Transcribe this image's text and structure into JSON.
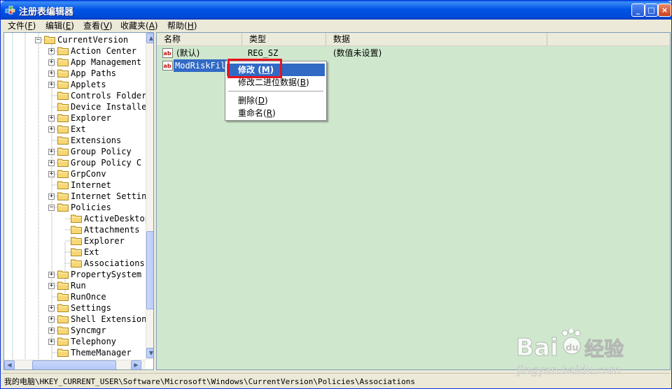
{
  "window": {
    "title": "注册表编辑器",
    "min": "_",
    "max": "□",
    "close": "×"
  },
  "menu": [
    {
      "label": "文件",
      "key": "F"
    },
    {
      "label": "编辑",
      "key": "E"
    },
    {
      "label": "查看",
      "key": "V"
    },
    {
      "label": "收藏夹",
      "key": "A"
    },
    {
      "label": "帮助",
      "key": "H"
    }
  ],
  "tree": {
    "items": [
      {
        "label": "CurrentVersion",
        "expander": "−"
      },
      {
        "label": "Action Center",
        "expander": "+"
      },
      {
        "label": "App Management",
        "expander": "+"
      },
      {
        "label": "App Paths",
        "expander": "+"
      },
      {
        "label": "Applets",
        "expander": "+"
      },
      {
        "label": "Controls Folder",
        "expander": ""
      },
      {
        "label": "Device Installer",
        "expander": ""
      },
      {
        "label": "Explorer",
        "expander": "+"
      },
      {
        "label": "Ext",
        "expander": "+"
      },
      {
        "label": "Extensions",
        "expander": ""
      },
      {
        "label": "Group Policy",
        "expander": "+"
      },
      {
        "label": "Group Policy C",
        "expander": "+"
      },
      {
        "label": "GrpConv",
        "expander": "+"
      },
      {
        "label": "Internet",
        "expander": ""
      },
      {
        "label": "Internet Settings",
        "expander": "+"
      },
      {
        "label": "Policies",
        "expander": "−"
      },
      {
        "label": "ActiveDesktop",
        "expander": ""
      },
      {
        "label": "Attachments",
        "expander": ""
      },
      {
        "label": "Explorer",
        "expander": ""
      },
      {
        "label": "Ext",
        "expander": ""
      },
      {
        "label": "Associations",
        "expander": ""
      },
      {
        "label": "PropertySystem",
        "expander": "+"
      },
      {
        "label": "Run",
        "expander": "+"
      },
      {
        "label": "RunOnce",
        "expander": ""
      },
      {
        "label": "Settings",
        "expander": "+"
      },
      {
        "label": "Shell Extensions",
        "expander": "+"
      },
      {
        "label": "Syncmgr",
        "expander": "+"
      },
      {
        "label": "Telephony",
        "expander": "+"
      },
      {
        "label": "ThemeManager",
        "expander": ""
      }
    ]
  },
  "list": {
    "headers": [
      "名称",
      "类型",
      "数据"
    ],
    "rows": [
      {
        "name": "(默认)",
        "type": "REG_SZ",
        "data": "(数值未设置)"
      },
      {
        "name": "ModRiskFileTypes",
        "type": "",
        "data": ""
      }
    ]
  },
  "context_menu": {
    "items": [
      {
        "label": "修改",
        "key": "M"
      },
      {
        "label": "修改二进位数据",
        "key": "B"
      },
      {
        "label": "删除",
        "key": "D"
      },
      {
        "label": "重命名",
        "key": "R"
      }
    ]
  },
  "status": {
    "path": "我的电脑\\HKEY_CURRENT_USER\\Software\\Microsoft\\Windows\\CurrentVersion\\Policies\\Associations"
  },
  "watermark": {
    "brand": "Bai",
    "paw": "du",
    "cn": "经验",
    "site": "jingyan.baidu.com"
  }
}
